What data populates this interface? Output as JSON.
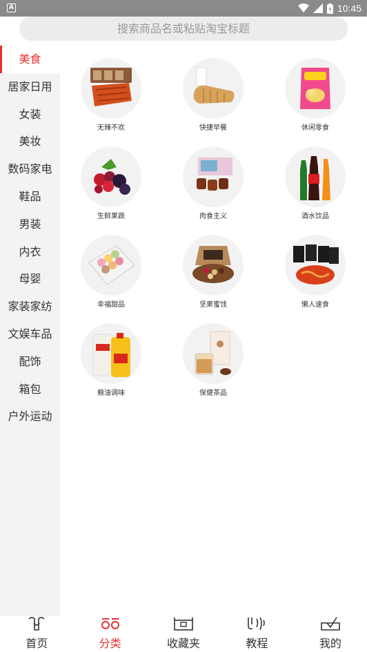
{
  "status_bar": {
    "time": "10:45",
    "app_icon_letter": "A"
  },
  "search": {
    "placeholder": "搜索商品名或粘贴淘宝标题"
  },
  "sidebar": {
    "active_index": 0,
    "items": [
      {
        "label": "美食"
      },
      {
        "label": "居家日用"
      },
      {
        "label": "女装"
      },
      {
        "label": "美妆"
      },
      {
        "label": "数码家电"
      },
      {
        "label": "鞋品"
      },
      {
        "label": "男装"
      },
      {
        "label": "内衣"
      },
      {
        "label": "母婴"
      },
      {
        "label": "家装家纺"
      },
      {
        "label": "文娱车品"
      },
      {
        "label": "配饰"
      },
      {
        "label": "箱包"
      },
      {
        "label": "户外运动"
      }
    ]
  },
  "categories": [
    {
      "label": "无辣不欢",
      "icon": "spicy-snack-icon"
    },
    {
      "label": "快捷早餐",
      "icon": "bread-icon"
    },
    {
      "label": "休闲零食",
      "icon": "chips-icon"
    },
    {
      "label": "生鲜果蔬",
      "icon": "berries-icon"
    },
    {
      "label": "肉食主义",
      "icon": "meat-icon"
    },
    {
      "label": "酒水饮品",
      "icon": "drinks-icon"
    },
    {
      "label": "幸福甜品",
      "icon": "macaron-icon"
    },
    {
      "label": "坚果蜜饯",
      "icon": "nuts-icon"
    },
    {
      "label": "懒人速食",
      "icon": "instant-noodle-icon"
    },
    {
      "label": "粮油调味",
      "icon": "rice-oil-icon"
    },
    {
      "label": "保健茶品",
      "icon": "tea-icon"
    }
  ],
  "bottom_nav": {
    "active_index": 1,
    "items": [
      {
        "label": "首页",
        "icon": "home-icon"
      },
      {
        "label": "分类",
        "icon": "category-icon"
      },
      {
        "label": "收藏夹",
        "icon": "favorites-icon"
      },
      {
        "label": "教程",
        "icon": "tutorial-icon"
      },
      {
        "label": "我的",
        "icon": "profile-icon"
      }
    ]
  },
  "colors": {
    "accent": "#e63232",
    "status_bar": "#8a8a8a",
    "sidebar_bg": "#f3f3f3",
    "search_bg": "#ececec"
  }
}
